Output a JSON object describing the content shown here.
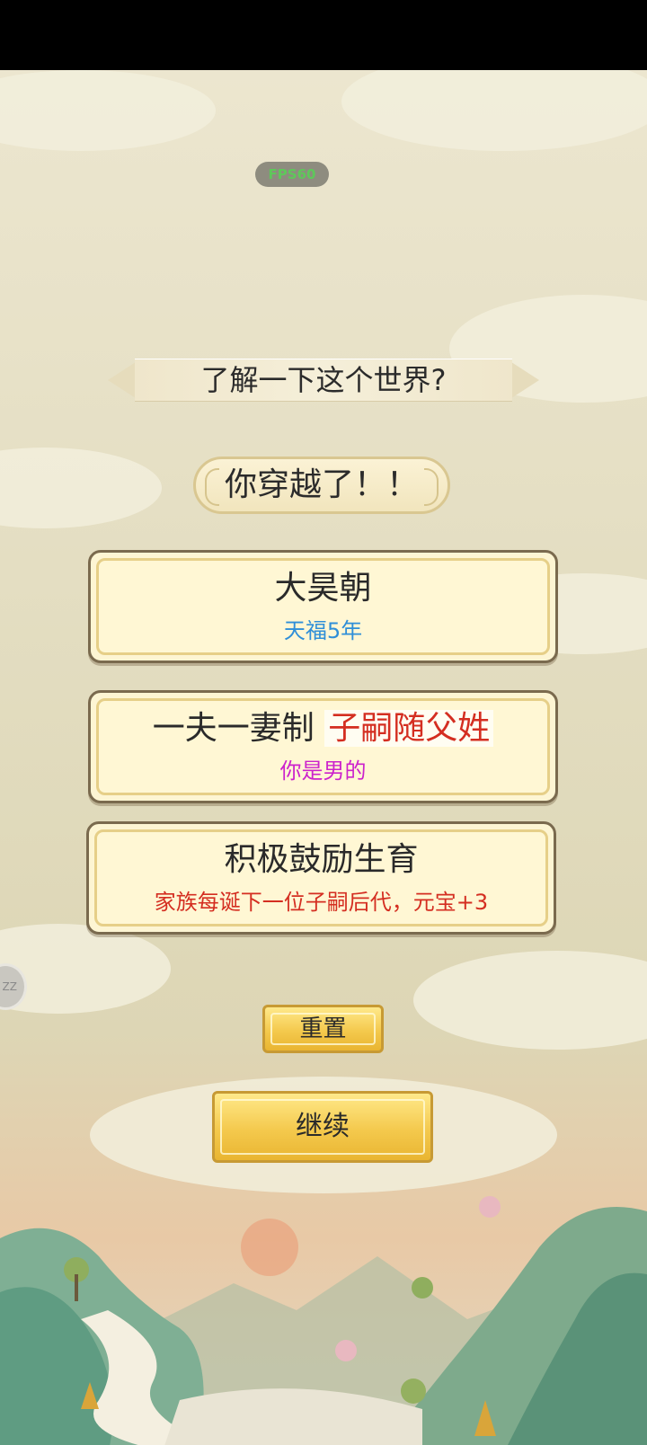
{
  "fps_label": "FPS60",
  "header": {
    "question": "了解一下这个世界?"
  },
  "intro": {
    "text": "你穿越了！！"
  },
  "cards": [
    {
      "title": "大昊朝",
      "subtitle": "天福5年",
      "subtitle_color": "#2f8fd8"
    },
    {
      "title": "一夫一妻制",
      "title_highlight": "子嗣随父姓",
      "subtitle": "你是男的",
      "subtitle_color": "#cc22cc"
    },
    {
      "title": "积极鼓励生育",
      "subtitle": "家族每诞下一位子嗣后代，元宝+3",
      "subtitle_color": "#d42e21"
    }
  ],
  "buttons": {
    "reset_label": "重置",
    "continue_label": "继续"
  },
  "side_button_label": "ZZ",
  "colors": {
    "title_red": "#d42e21",
    "button_gold": "#f4c94d",
    "card_cream": "#fff7d4",
    "card_border": "#7a6a4e"
  }
}
